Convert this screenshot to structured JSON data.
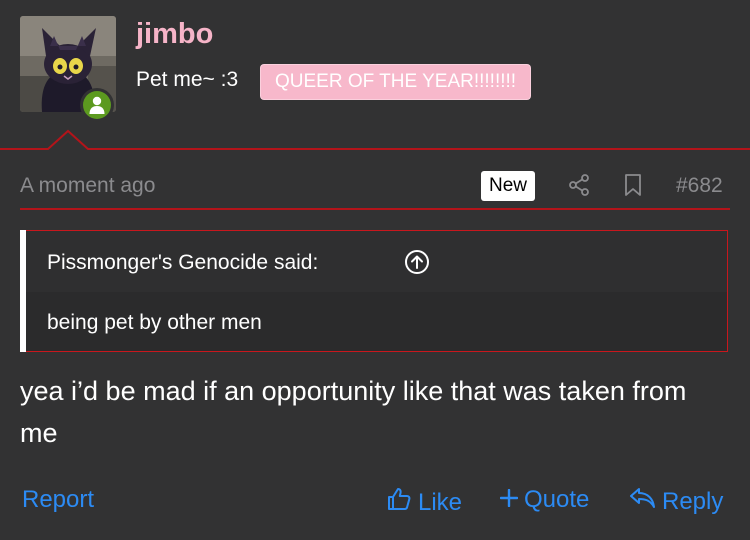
{
  "user": {
    "name": "jimbo",
    "title": "Pet me~ :3",
    "banner": "QUEER OF THE YEAR!!!!!!!!",
    "status": "online"
  },
  "meta": {
    "timestamp": "A moment ago",
    "new_badge": "New",
    "post_number": "#682",
    "icons": [
      "share-icon",
      "bookmark-icon"
    ]
  },
  "quote": {
    "author_line": "Pissmonger's Genocide said:",
    "text": "being pet by other men"
  },
  "post": {
    "text": "yea i’d be mad if an opportunity like that was taken from me"
  },
  "actions": {
    "report": "Report",
    "like": "Like",
    "quote": "Quote",
    "reply": "Reply"
  },
  "colors": {
    "background": "#323233",
    "username": "#f6b4c8",
    "banner": "#f7b8cb",
    "accent_red": "#c8171d",
    "link_blue": "#2c8bf4",
    "online_green": "#5c9a1f"
  }
}
